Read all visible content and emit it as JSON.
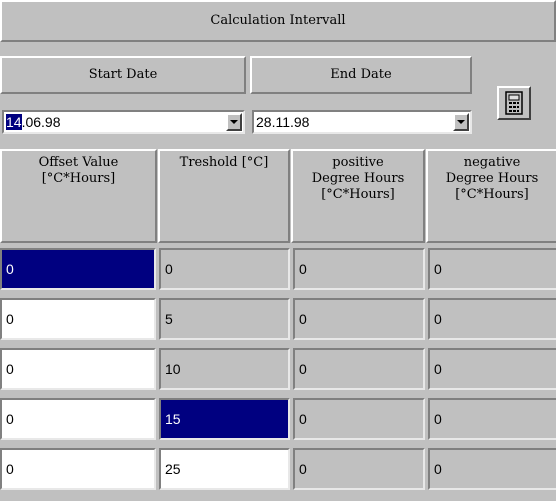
{
  "panel": {
    "title": "Calculation Intervall",
    "start_label": "Start Date",
    "end_label": "End Date",
    "start_value_selected": "14",
    "start_value_rest": ".06.98",
    "end_value": "28.11.98",
    "calculator_icon": "calculator-icon"
  },
  "table": {
    "headers": [
      "Offset Value\n[°C*Hours]",
      "Treshold [°C]",
      "positive\nDegree Hours\n[°C*Hours]",
      "negative\nDegree Hours\n[°C*Hours]"
    ],
    "rows": [
      [
        "0",
        "0",
        "0",
        "0"
      ],
      [
        "0",
        "5",
        "0",
        "0"
      ],
      [
        "0",
        "10",
        "0",
        "0"
      ],
      [
        "0",
        "15",
        "0",
        "0"
      ],
      [
        "0",
        "25",
        "0",
        "0"
      ]
    ]
  },
  "colors": {
    "face": "#c0c0c0",
    "selection": "#000080",
    "field": "#ffffff"
  }
}
